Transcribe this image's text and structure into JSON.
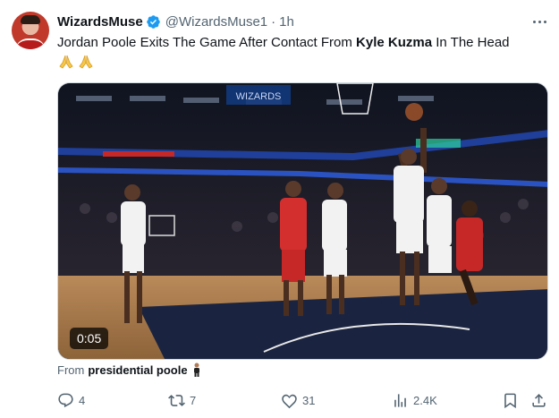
{
  "tweet": {
    "author_name": "WizardsMuse",
    "handle": "@WizardsMuse1",
    "separator": "·",
    "time": "1h",
    "text_prefix": "Jordan Poole Exits The Game After Contact From ",
    "text_bold": "Kyle Kuzma",
    "text_suffix": " In The Head",
    "emojis": [
      "folded-hands-emoji",
      "folded-hands-emoji"
    ]
  },
  "media": {
    "duration": "0:05",
    "banner_text": "WIZARDS"
  },
  "source": {
    "from_label": "From",
    "from_name": "presidential poole"
  },
  "actions": {
    "replies": "4",
    "reposts": "7",
    "likes": "31",
    "views": "2.4K"
  },
  "colors": {
    "icon_gray": "#536471",
    "text_dark": "#0f1419",
    "verified_blue": "#1d9bf0"
  }
}
